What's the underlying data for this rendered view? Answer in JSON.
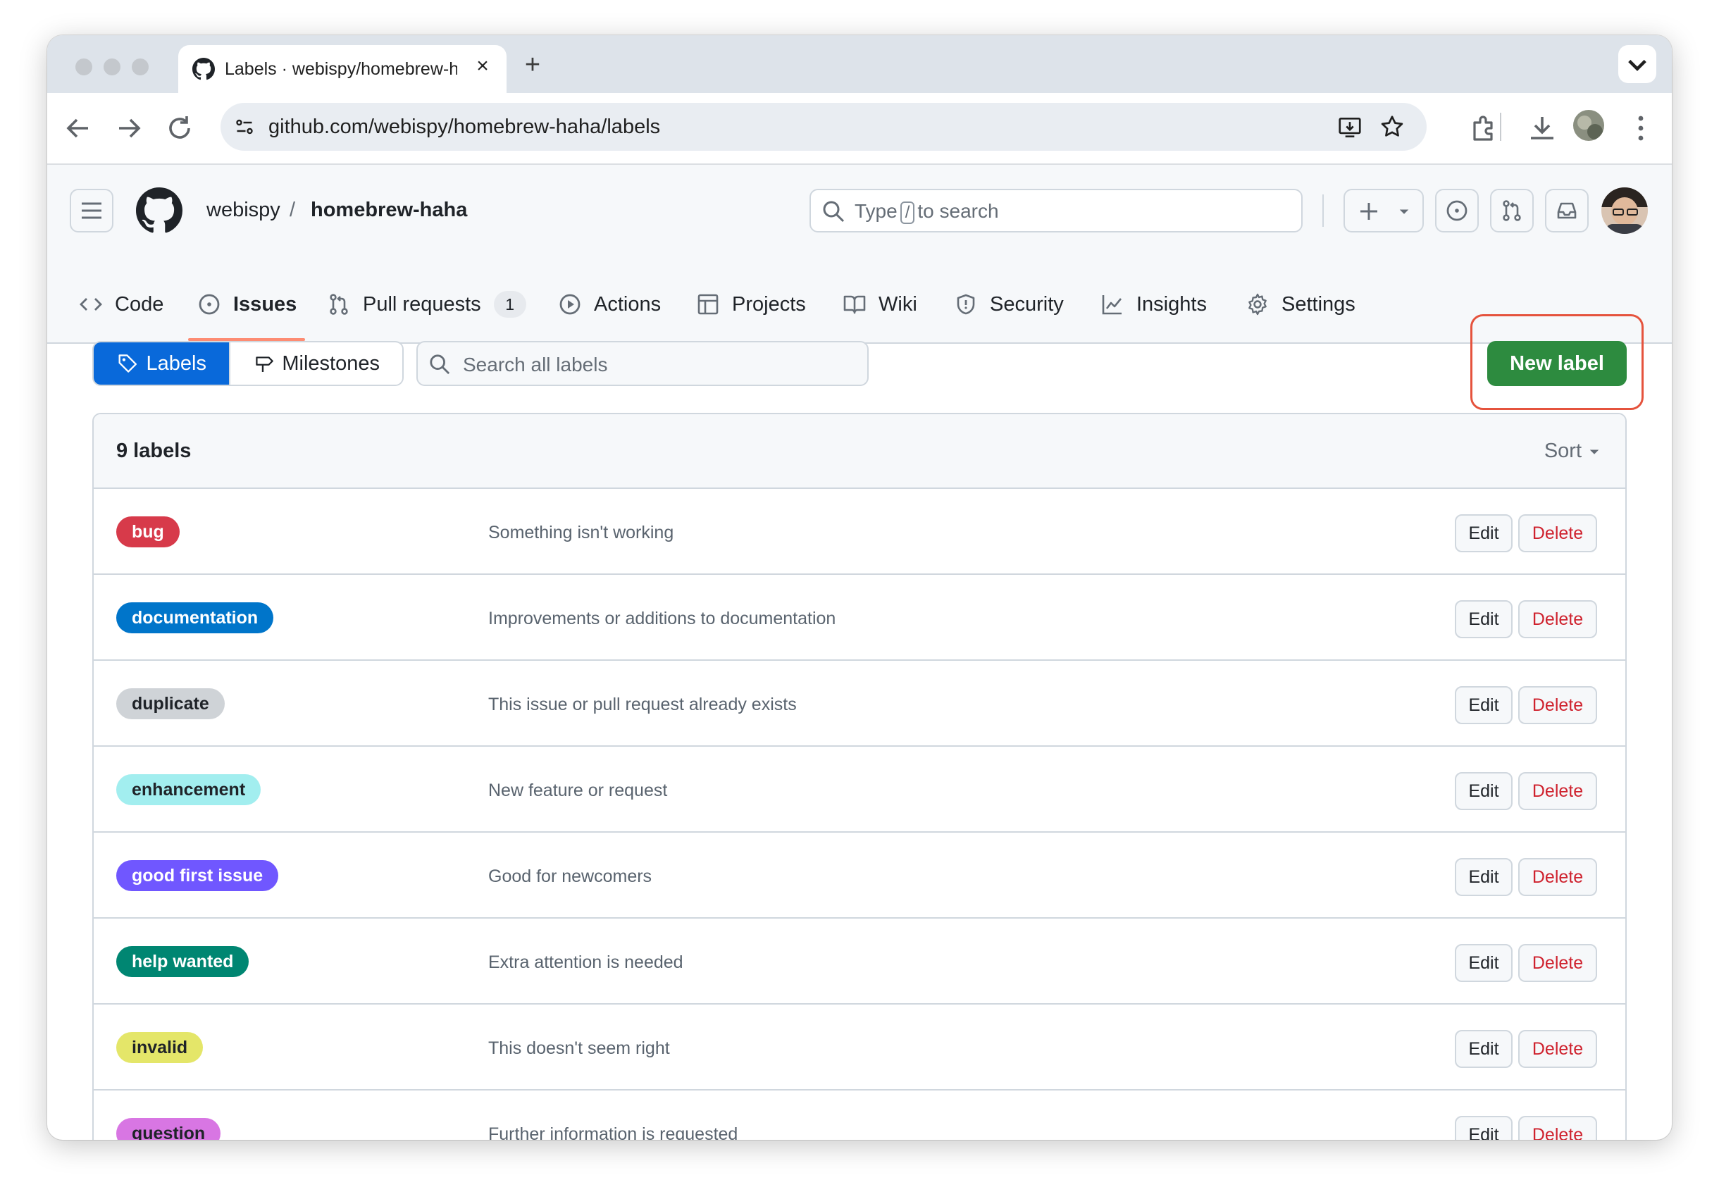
{
  "browser": {
    "tab_title": "Labels · webispy/homebrew-haha",
    "url": "github.com/webispy/homebrew-haha/labels"
  },
  "header": {
    "owner": "webispy",
    "separator": "/",
    "repo": "homebrew-haha",
    "search_prefix": "Type",
    "search_key": "/",
    "search_suffix": "to search"
  },
  "repo_nav": {
    "code": "Code",
    "issues": "Issues",
    "pulls": "Pull requests",
    "pulls_count": "1",
    "actions": "Actions",
    "projects": "Projects",
    "wiki": "Wiki",
    "security": "Security",
    "insights": "Insights",
    "settings": "Settings"
  },
  "toolbar": {
    "labels_tab": "Labels",
    "milestones_tab": "Milestones",
    "search_placeholder": "Search all labels",
    "new_label": "New label"
  },
  "labels_box": {
    "count_text": "9 labels",
    "sort_label": "Sort",
    "edit_label": "Edit",
    "delete_label": "Delete",
    "rows": [
      {
        "name": "bug",
        "description": "Something isn't working",
        "color": "#d73a4a",
        "text_color": "#ffffff"
      },
      {
        "name": "documentation",
        "description": "Improvements or additions to documentation",
        "color": "#0075ca",
        "text_color": "#ffffff"
      },
      {
        "name": "duplicate",
        "description": "This issue or pull request already exists",
        "color": "#cfd3d7",
        "text_color": "#1f2328"
      },
      {
        "name": "enhancement",
        "description": "New feature or request",
        "color": "#a2eeef",
        "text_color": "#1f2328"
      },
      {
        "name": "good first issue",
        "description": "Good for newcomers",
        "color": "#7057ff",
        "text_color": "#ffffff"
      },
      {
        "name": "help wanted",
        "description": "Extra attention is needed",
        "color": "#008672",
        "text_color": "#ffffff"
      },
      {
        "name": "invalid",
        "description": "This doesn't seem right",
        "color": "#e4e669",
        "text_color": "#1f2328"
      },
      {
        "name": "question",
        "description": "Further information is requested",
        "color": "#d876e3",
        "text_color": "#1f2328"
      }
    ]
  }
}
